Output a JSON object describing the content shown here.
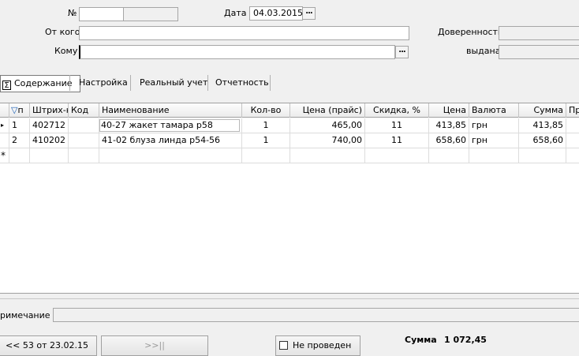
{
  "header": {
    "number_label": "№",
    "number_value": "",
    "date_label": "Дата",
    "date_value": "04.03.2015",
    "from_label": "От кого",
    "from_value": "",
    "to_label": "Кому",
    "to_value": "",
    "proxy_label": "Доверенность",
    "proxy_value": "",
    "issued_label": "выдана",
    "issued_value": "",
    "ellipsis": "..."
  },
  "tabs": [
    {
      "label": "Содержание",
      "active": true
    },
    {
      "label": "Настройка",
      "active": false
    },
    {
      "label": "Реальный учет",
      "active": false
    },
    {
      "label": "Отчетность",
      "active": false
    }
  ],
  "grid": {
    "columns": [
      "п",
      "Штрих-к",
      "Код",
      "Наименование",
      "Кол-во",
      "Цена (прайс)",
      "Скидка, %",
      "Цена",
      "Валюта",
      "Сумма",
      "Пр"
    ],
    "rows": [
      {
        "n": "1",
        "barcode": "402712",
        "code": "",
        "name": "40-27 жакет тамара р58",
        "qty": "1",
        "price_list": "465,00",
        "discount": "11",
        "price": "413,85",
        "currency": "грн",
        "sum": "413,85"
      },
      {
        "n": "2",
        "barcode": "410202",
        "code": "",
        "name": "41-02 блуза линда р54-56",
        "qty": "1",
        "price_list": "740,00",
        "discount": "11",
        "price": "658,60",
        "currency": "грн",
        "sum": "658,60"
      }
    ],
    "new_row_marker": "*"
  },
  "note": {
    "label": "римечание",
    "value": ""
  },
  "footer": {
    "prev_button": "<< 53 от 23.02.15",
    "next_button": ">>||",
    "not_posted_label": "Не проведен",
    "sum_label": "Сумма",
    "sum_value": "1 072,45"
  },
  "colors": {
    "accent": "#1a5fb4",
    "selected_border": "#7a7a7a"
  }
}
